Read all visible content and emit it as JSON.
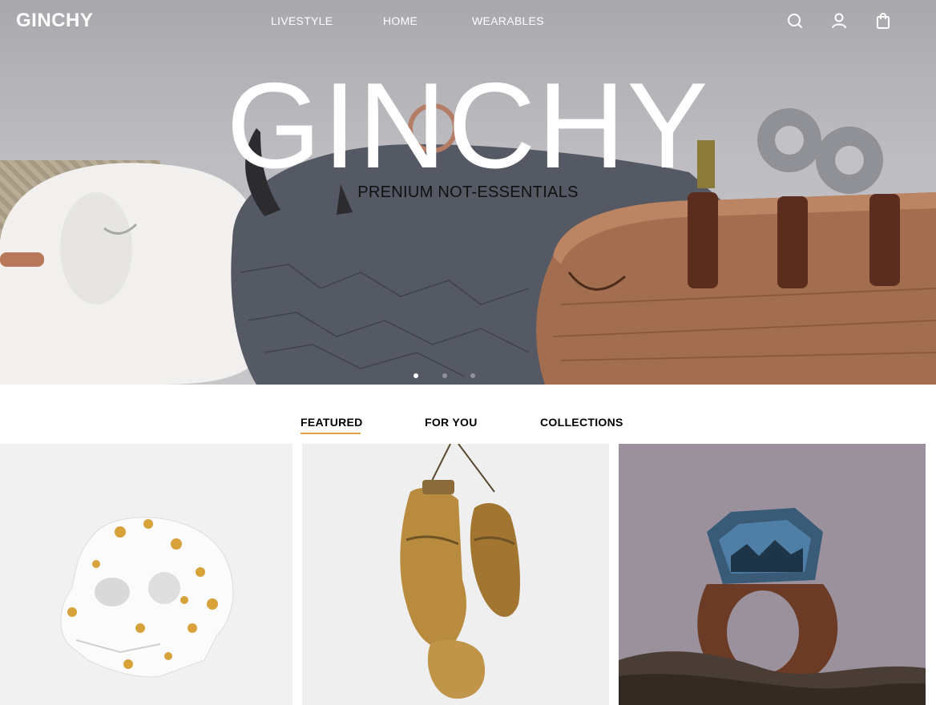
{
  "header": {
    "brand": "GINCHY",
    "nav": [
      {
        "label": "LIVESTYLE"
      },
      {
        "label": "HOME"
      },
      {
        "label": "WEARABLES"
      }
    ],
    "icons": [
      "search-icon",
      "user-icon",
      "bag-icon"
    ]
  },
  "hero": {
    "title": "GINCHY",
    "subtitle": "PRENIUM NOT-ESSENTIALS",
    "slides": 3,
    "active_slide": 1
  },
  "tabs": [
    {
      "label": "FEATURED",
      "active": true
    },
    {
      "label": "FOR YOU",
      "active": false
    },
    {
      "label": "COLLECTIONS",
      "active": false
    }
  ],
  "products": [
    "skull-image",
    "boxing-gloves-image",
    "ring-image"
  ],
  "colors": {
    "accent": "#e0a14a",
    "text": "#000000",
    "hero_text": "#ffffff"
  }
}
